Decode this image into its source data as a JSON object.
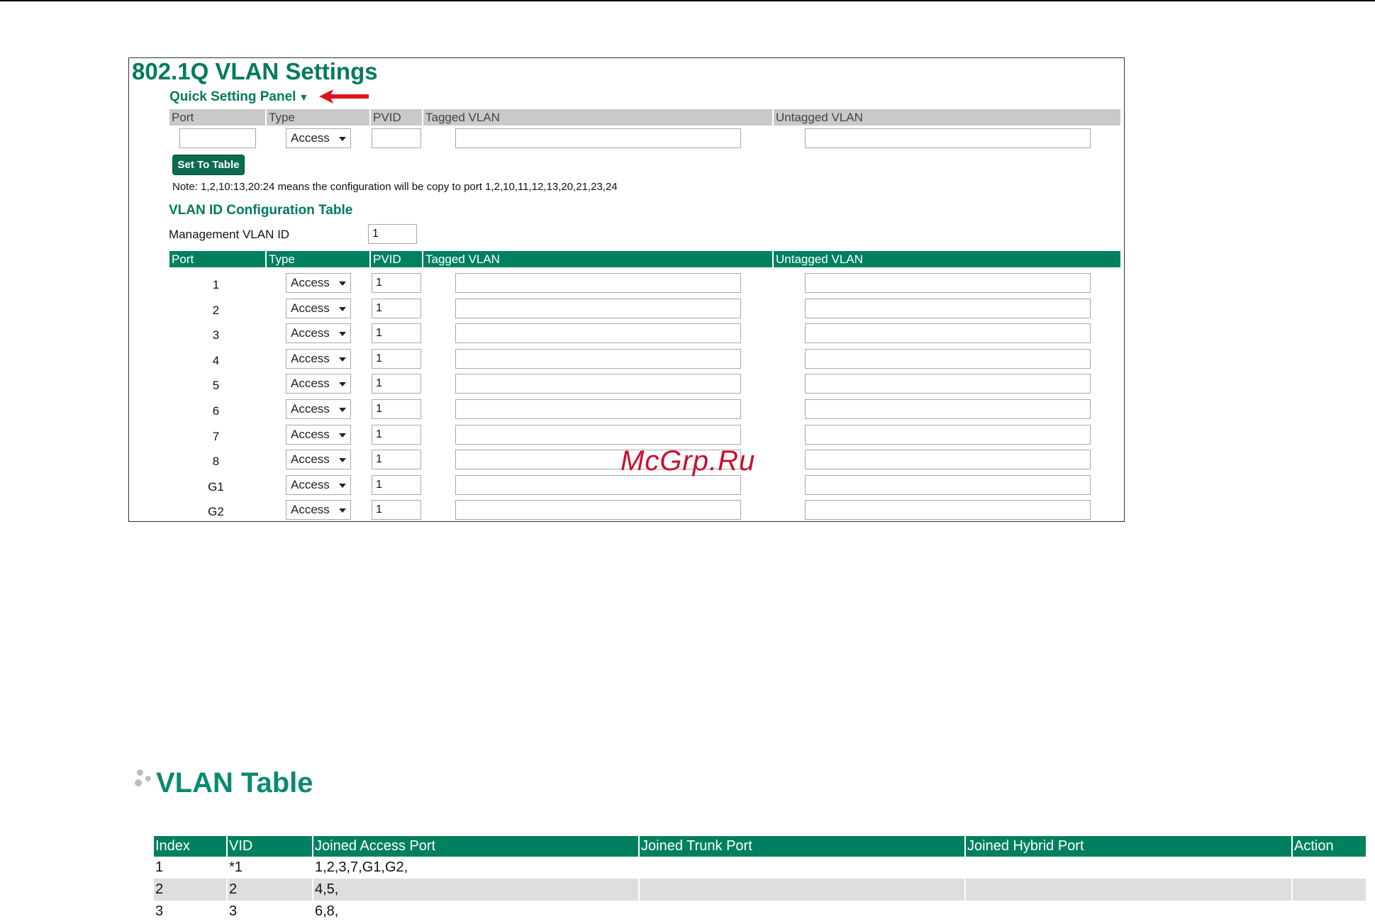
{
  "settings": {
    "title": "802.1Q VLAN Settings",
    "quick_panel": {
      "title": "Quick Setting Panel",
      "toggle_glyph": "▼",
      "columns": {
        "port": "Port",
        "type": "Type",
        "pvid": "PVID",
        "tagged": "Tagged VLAN",
        "untagged": "Untagged VLAN"
      },
      "port_value": "",
      "type_value": "Access",
      "pvid_value": "",
      "tagged_value": "",
      "untagged_value": "",
      "set_button": "Set To Table",
      "note": "Note: 1,2,10:13,20:24 means the configuration will be copy to port 1,2,10,11,12,13,20,21,23,24"
    },
    "config_table": {
      "title": "VLAN ID Configuration Table",
      "management_label": "Management VLAN ID",
      "management_value": "1",
      "columns": {
        "port": "Port",
        "type": "Type",
        "pvid": "PVID",
        "tagged": "Tagged VLAN",
        "untagged": "Untagged VLAN"
      },
      "rows": [
        {
          "port": "1",
          "type": "Access",
          "pvid": "1",
          "tagged": "",
          "untagged": ""
        },
        {
          "port": "2",
          "type": "Access",
          "pvid": "1",
          "tagged": "",
          "untagged": ""
        },
        {
          "port": "3",
          "type": "Access",
          "pvid": "1",
          "tagged": "",
          "untagged": ""
        },
        {
          "port": "4",
          "type": "Access",
          "pvid": "1",
          "tagged": "",
          "untagged": ""
        },
        {
          "port": "5",
          "type": "Access",
          "pvid": "1",
          "tagged": "",
          "untagged": ""
        },
        {
          "port": "6",
          "type": "Access",
          "pvid": "1",
          "tagged": "",
          "untagged": ""
        },
        {
          "port": "7",
          "type": "Access",
          "pvid": "1",
          "tagged": "",
          "untagged": ""
        },
        {
          "port": "8",
          "type": "Access",
          "pvid": "1",
          "tagged": "",
          "untagged": ""
        },
        {
          "port": "G1",
          "type": "Access",
          "pvid": "1",
          "tagged": "",
          "untagged": ""
        },
        {
          "port": "G2",
          "type": "Access",
          "pvid": "1",
          "tagged": "",
          "untagged": ""
        }
      ]
    }
  },
  "watermark": "McGrp.Ru",
  "vlan_table": {
    "title": "VLAN Table",
    "icon": "dots-icon",
    "columns": [
      "Index",
      "VID",
      "Joined Access Port",
      "Joined Trunk Port",
      "Joined Hybrid Port",
      "Action"
    ],
    "rows": [
      [
        "1",
        "*1",
        "1,2,3,7,G1,G2,",
        "",
        "",
        ""
      ],
      [
        "2",
        "2",
        "4,5,",
        "",
        "",
        ""
      ],
      [
        "3",
        "3",
        "6,8,",
        "",
        "",
        ""
      ]
    ]
  },
  "colors": {
    "accent_green": "#00805f",
    "title_green": "#007a5e",
    "header_gray": "#c9c9c9",
    "alt_row": "#dedede",
    "arrow_red": "#e0141e"
  }
}
